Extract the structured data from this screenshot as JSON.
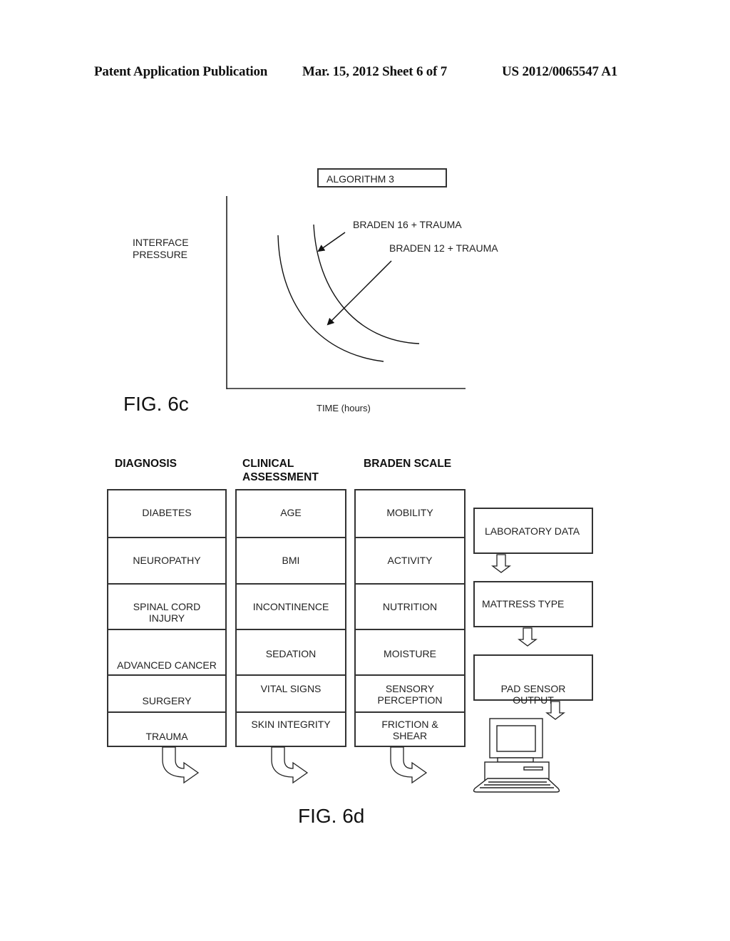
{
  "header": {
    "publication": "Patent Application Publication",
    "date_sheet": "Mar. 15, 2012  Sheet 6 of 7",
    "number": "US 2012/0065547 A1"
  },
  "fig6c": {
    "caption": "FIG. 6c",
    "title_box": "ALGORITHM 3",
    "y_label_line1": "INTERFACE",
    "y_label_line2": "PRESSURE",
    "x_label": "TIME (hours)",
    "annotations": [
      "BRADEN 16 + TRAUMA",
      "BRADEN 12 + TRAUMA"
    ]
  },
  "chart_data": {
    "type": "line",
    "title": "ALGORITHM 3",
    "xlabel": "TIME (hours)",
    "ylabel": "INTERFACE PRESSURE",
    "grid": false,
    "ticks": "none",
    "series": [
      {
        "name": "BRADEN 12 + TRAUMA",
        "shape": "decreasing convex curve (left/lower)"
      },
      {
        "name": "BRADEN 16 + TRAUMA",
        "shape": "decreasing convex curve (right/upper)"
      }
    ],
    "annotations": [
      {
        "text": "BRADEN 16 + TRAUMA",
        "points_to": "BRADEN 16 + TRAUMA"
      },
      {
        "text": "BRADEN 12 + TRAUMA",
        "points_to": "BRADEN 12 + TRAUMA"
      }
    ]
  },
  "fig6d": {
    "caption": "FIG. 6d",
    "columns": [
      {
        "heading": "DIAGNOSIS",
        "items": [
          "DIABETES",
          "NEUROPATHY",
          "SPINAL CORD\nINJURY",
          "ADVANCED CANCER",
          "SURGERY",
          "TRAUMA"
        ]
      },
      {
        "heading": "CLINICAL\nASSESSMENT",
        "items": [
          "AGE",
          "BMI",
          "INCONTINENCE",
          "SEDATION",
          "VITAL SIGNS",
          "SKIN INTEGRITY"
        ]
      },
      {
        "heading": "BRADEN SCALE",
        "items": [
          "MOBILITY",
          "ACTIVITY",
          "NUTRITION",
          "MOISTURE",
          "SENSORY\nPERCEPTION",
          "FRICTION &\nSHEAR"
        ]
      }
    ],
    "side_boxes": [
      "LABORATORY DATA",
      "MATTRESS TYPE",
      "PAD SENSOR\nOUTPUT"
    ],
    "icons": [
      "curved-arrow-icon",
      "down-arrow-icon",
      "computer-icon"
    ]
  }
}
